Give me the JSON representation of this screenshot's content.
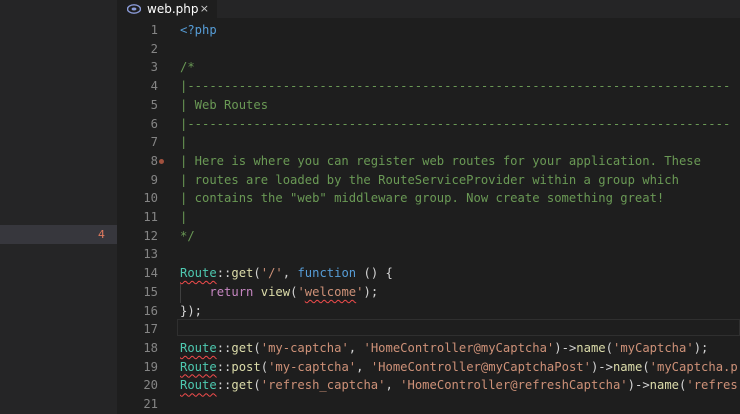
{
  "tab": {
    "title": "web.php",
    "close_glyph": "×",
    "icon": "php-file-icon",
    "icon_color": "#8a9bd8"
  },
  "sidebar": {
    "highlight_badge": "4",
    "badge_color": "#e07a5f"
  },
  "colors": {
    "background": "#1e1e1e",
    "sidebar": "#252526",
    "comment": "#6a9955",
    "keyword": "#569cd6",
    "class": "#4ec9b0",
    "function": "#dcdcaa",
    "string": "#ce9178",
    "control": "#c586c0",
    "error_squiggle": "#f14c4c"
  },
  "lines": [
    {
      "num": "1",
      "tokens": [
        {
          "c": "t",
          "text": "<?php"
        }
      ]
    },
    {
      "num": "2",
      "tokens": []
    },
    {
      "num": "3",
      "tokens": [
        {
          "c": "c",
          "text": "/*"
        }
      ]
    },
    {
      "num": "4",
      "tokens": [
        {
          "c": "c",
          "text": "|--------------------------------------------------------------------------"
        }
      ]
    },
    {
      "num": "5",
      "tokens": [
        {
          "c": "c",
          "text": "| Web Routes"
        }
      ]
    },
    {
      "num": "6",
      "tokens": [
        {
          "c": "c",
          "text": "|--------------------------------------------------------------------------"
        }
      ]
    },
    {
      "num": "7",
      "tokens": [
        {
          "c": "c",
          "text": "|"
        }
      ]
    },
    {
      "num": "8",
      "breakpoint": true,
      "tokens": [
        {
          "c": "c",
          "text": "| Here is where you can register web routes for your application. These"
        }
      ]
    },
    {
      "num": "9",
      "tokens": [
        {
          "c": "c",
          "text": "| routes are loaded by the RouteServiceProvider within a group which"
        }
      ]
    },
    {
      "num": "10",
      "tokens": [
        {
          "c": "c",
          "text": "| contains the \"web\" middleware group. Now create something great!"
        }
      ]
    },
    {
      "num": "11",
      "tokens": [
        {
          "c": "c",
          "text": "|"
        }
      ]
    },
    {
      "num": "12",
      "tokens": [
        {
          "c": "c",
          "text": "*/"
        }
      ]
    },
    {
      "num": "13",
      "tokens": []
    },
    {
      "num": "14",
      "tokens": [
        {
          "c": "cls squig",
          "text": "Route"
        },
        {
          "c": "op",
          "text": "::"
        },
        {
          "c": "fn",
          "text": "get"
        },
        {
          "c": "op",
          "text": "("
        },
        {
          "c": "s",
          "text": "'/'"
        },
        {
          "c": "op",
          "text": ", "
        },
        {
          "c": "kw",
          "text": "function"
        },
        {
          "c": "op",
          "text": " () {"
        }
      ]
    },
    {
      "num": "15",
      "tokens": [
        {
          "c": "op",
          "text": "    "
        },
        {
          "c": "kc",
          "text": "return"
        },
        {
          "c": "op",
          "text": " "
        },
        {
          "c": "fn",
          "text": "view"
        },
        {
          "c": "op",
          "text": "("
        },
        {
          "c": "s",
          "text": "'"
        },
        {
          "c": "s squig",
          "text": "welcome"
        },
        {
          "c": "s",
          "text": "'"
        },
        {
          "c": "op",
          "text": ");"
        }
      ]
    },
    {
      "num": "16",
      "tokens": [
        {
          "c": "op",
          "text": "});"
        }
      ]
    },
    {
      "num": "17",
      "tokens": []
    },
    {
      "num": "18",
      "tokens": [
        {
          "c": "cls squig",
          "text": "Route"
        },
        {
          "c": "op",
          "text": "::"
        },
        {
          "c": "fn",
          "text": "get"
        },
        {
          "c": "op",
          "text": "("
        },
        {
          "c": "s",
          "text": "'my-captcha'"
        },
        {
          "c": "op",
          "text": ", "
        },
        {
          "c": "s",
          "text": "'HomeController@myCaptcha'"
        },
        {
          "c": "op",
          "text": ")->"
        },
        {
          "c": "fn",
          "text": "name"
        },
        {
          "c": "op",
          "text": "("
        },
        {
          "c": "s",
          "text": "'myCaptcha'"
        },
        {
          "c": "op",
          "text": ");"
        }
      ]
    },
    {
      "num": "19",
      "tokens": [
        {
          "c": "cls squig",
          "text": "Route"
        },
        {
          "c": "op",
          "text": "::"
        },
        {
          "c": "fn",
          "text": "post"
        },
        {
          "c": "op",
          "text": "("
        },
        {
          "c": "s",
          "text": "'my-captcha'"
        },
        {
          "c": "op",
          "text": ", "
        },
        {
          "c": "s",
          "text": "'HomeController@myCaptchaPost'"
        },
        {
          "c": "op",
          "text": ")->"
        },
        {
          "c": "fn",
          "text": "name"
        },
        {
          "c": "op",
          "text": "("
        },
        {
          "c": "s",
          "text": "'myCaptcha.p"
        }
      ]
    },
    {
      "num": "20",
      "tokens": [
        {
          "c": "cls squig",
          "text": "Route"
        },
        {
          "c": "op",
          "text": "::"
        },
        {
          "c": "fn",
          "text": "get"
        },
        {
          "c": "op",
          "text": "("
        },
        {
          "c": "s",
          "text": "'refresh_captcha'"
        },
        {
          "c": "op",
          "text": ", "
        },
        {
          "c": "s",
          "text": "'HomeController@refreshCaptcha'"
        },
        {
          "c": "op",
          "text": ")->"
        },
        {
          "c": "fn",
          "text": "name"
        },
        {
          "c": "op",
          "text": "("
        },
        {
          "c": "s",
          "text": "'refres"
        }
      ]
    },
    {
      "num": "21",
      "tokens": []
    }
  ]
}
